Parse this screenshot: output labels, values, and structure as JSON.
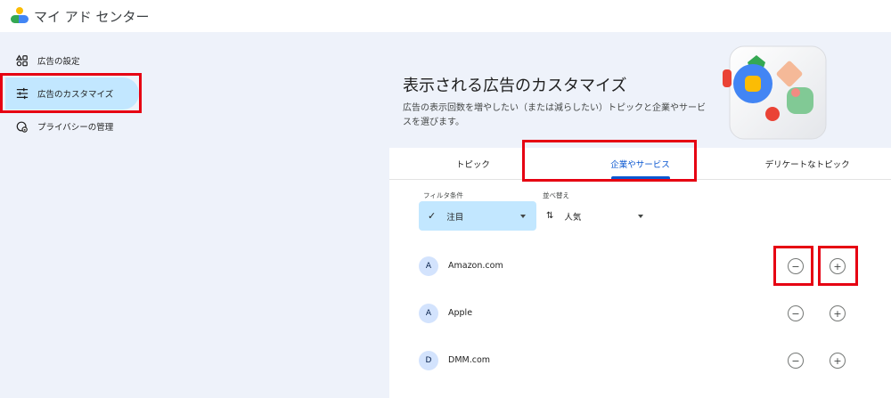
{
  "app": {
    "title": "マイ アド センター"
  },
  "sidebar": {
    "items": [
      {
        "label": "広告の設定",
        "icon": "ad-settings-icon"
      },
      {
        "label": "広告のカスタマイズ",
        "icon": "tune-icon"
      },
      {
        "label": "プライバシーの管理",
        "icon": "privacy-icon"
      }
    ]
  },
  "hero": {
    "title": "表示される広告のカスタマイズ",
    "description": "広告の表示回数を増やしたい（または減らしたい）トピックと企業やサービスを選びます。"
  },
  "tabs": [
    {
      "label": "トピック"
    },
    {
      "label": "企業やサービス"
    },
    {
      "label": "デリケートなトピック"
    }
  ],
  "filter": {
    "label": "フィルタ条件",
    "value": "注目"
  },
  "sort": {
    "label": "並べ替え",
    "value": "人気"
  },
  "companies": [
    {
      "initial": "A",
      "name": "Amazon.com"
    },
    {
      "initial": "A",
      "name": "Apple"
    },
    {
      "initial": "D",
      "name": "DMM.com"
    }
  ],
  "colors": {
    "accent": "#0b57d0",
    "active_bg": "#c2e7ff",
    "highlight": "#e60012",
    "page_bg": "#eef2fa"
  }
}
